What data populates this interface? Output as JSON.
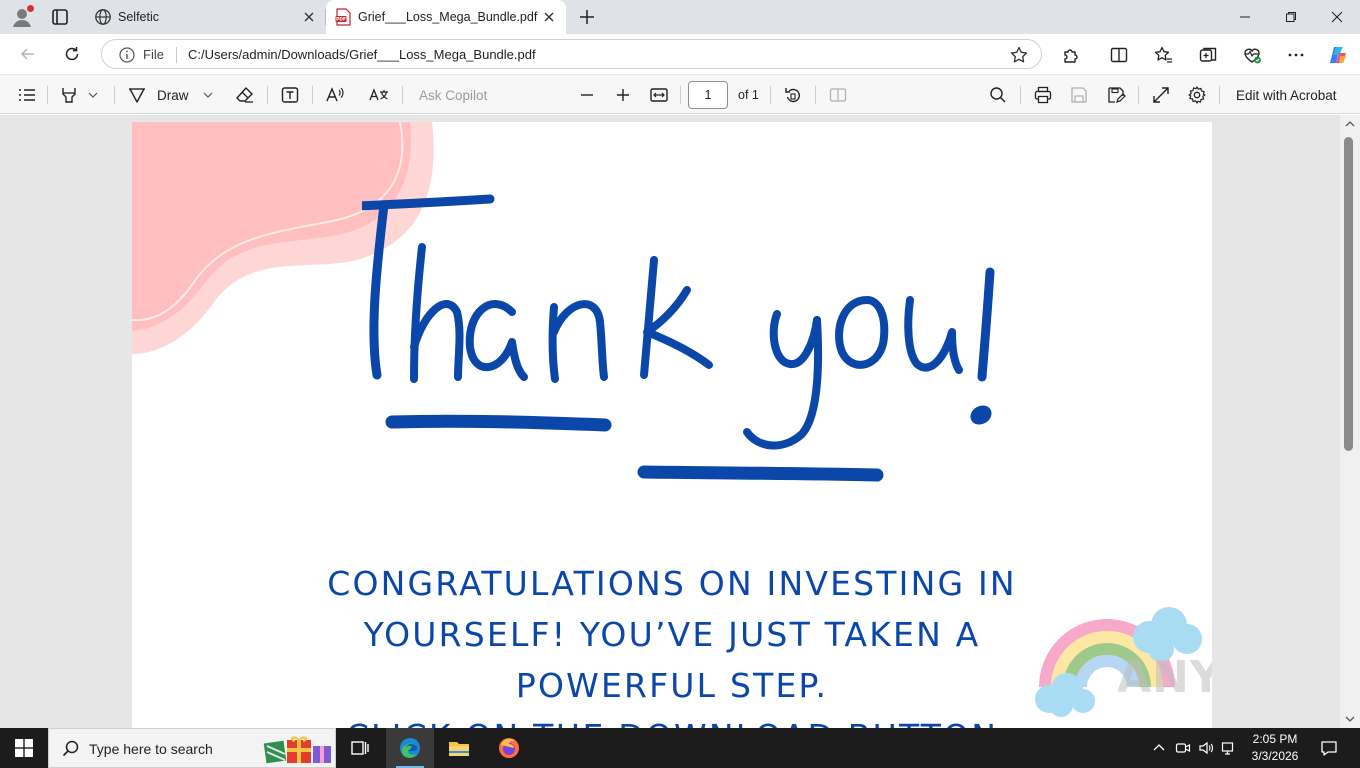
{
  "browser": {
    "tabs": [
      {
        "title": "Selfetic",
        "active": false
      },
      {
        "title": "Grief___Loss_Mega_Bundle.pdf",
        "active": true
      }
    ],
    "address": {
      "label": "File",
      "url": "C:/Users/admin/Downloads/Grief___Loss_Mega_Bundle.pdf"
    }
  },
  "pdf_toolbar": {
    "draw_label": "Draw",
    "ask_copilot_label": "Ask Copilot",
    "page_current": "1",
    "page_total_label": "of 1",
    "edit_with_acrobat_label": "Edit with Acrobat"
  },
  "document": {
    "script_title": "Thank you!",
    "congrats_lines": [
      "CONGRATULATIONS ON INVESTING IN",
      "YOURSELF! YOU’VE JUST TAKEN A",
      "POWERFUL STEP.",
      "CLICK ON THE DOWNLOAD BUTTON"
    ],
    "watermark": "ANY RUN",
    "colors": {
      "title_blue": "#0b47a8",
      "blob_pink": "#ffbfc0",
      "blob_light": "#ffd6d6"
    }
  },
  "taskbar": {
    "search_placeholder": "Type here to search",
    "time": "2:05 PM",
    "date": "3/3/2026"
  }
}
